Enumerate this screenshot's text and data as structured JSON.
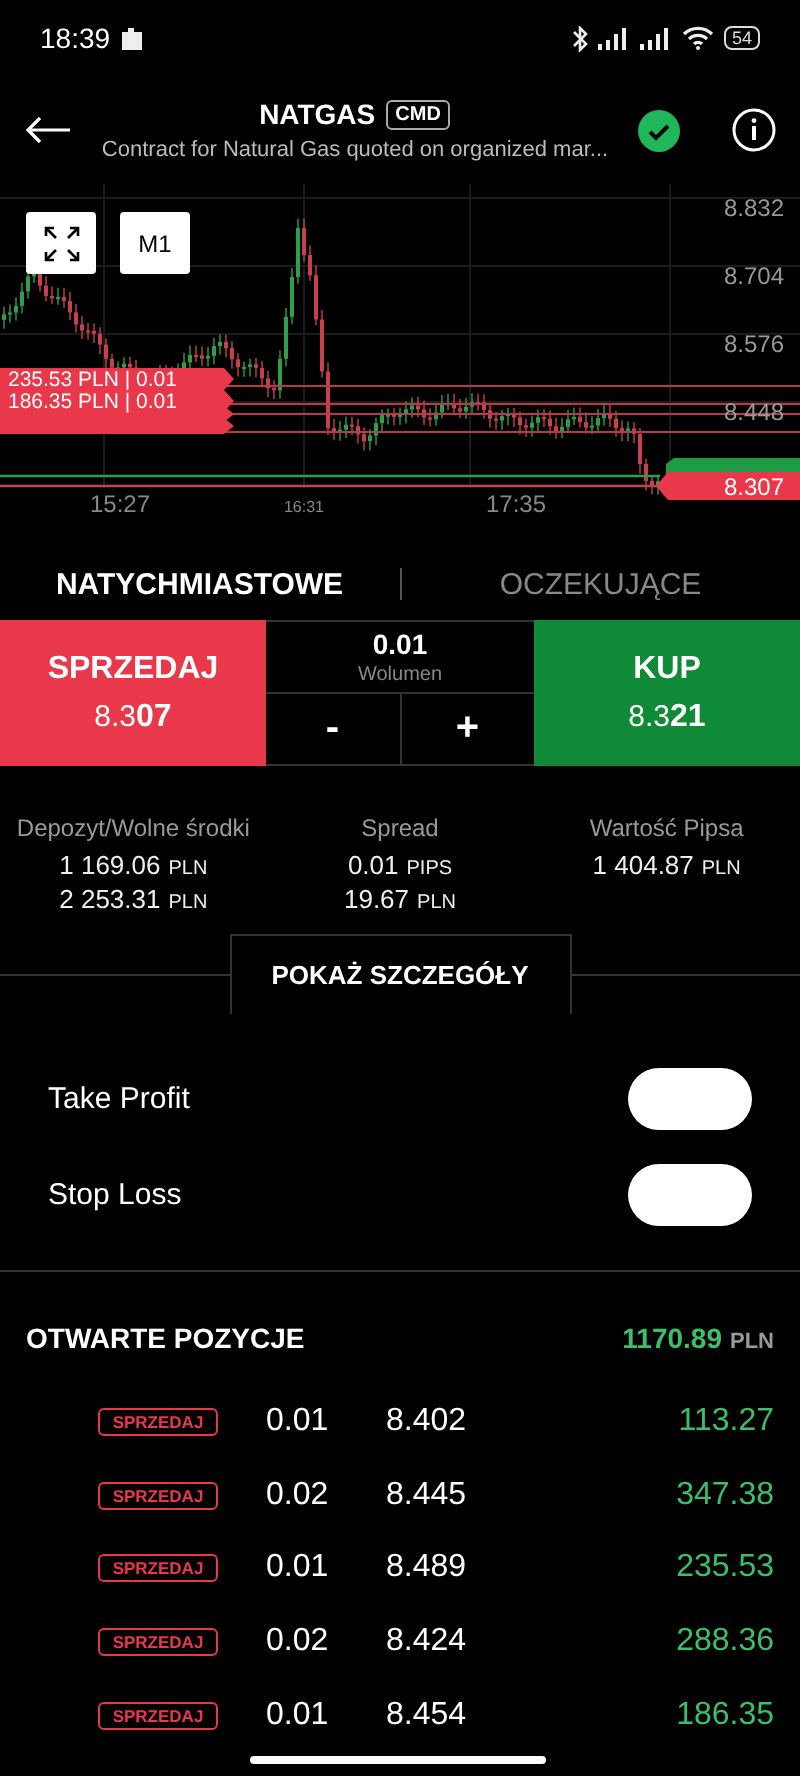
{
  "status_bar": {
    "time": "18:39",
    "battery": "54"
  },
  "header": {
    "title": "NATGAS",
    "badge": "CMD",
    "subtitle": "Contract for Natural Gas quoted on organized mar..."
  },
  "chart": {
    "timeframe": "M1",
    "y_ticks": [
      "8.832",
      "8.704",
      "8.576",
      "8.448"
    ],
    "x_ticks": [
      {
        "label": "15:27",
        "minor": false
      },
      {
        "label": "16:31",
        "minor": true
      },
      {
        "label": "17:35",
        "minor": false
      }
    ],
    "order_tags": [
      "235.53 PLN | 0.01",
      "186.35 PLN | 0.01"
    ],
    "price_tag": "8.307"
  },
  "order_tabs": [
    {
      "label": "NATYCHMIASTOWE",
      "selected": true
    },
    {
      "label": "OCZEKUJĄCE",
      "selected": false
    }
  ],
  "trade": {
    "sell": {
      "label": "SPRZEDAJ",
      "price": "8.3**07**"
    },
    "volume": {
      "value": "0.01",
      "label": "Wolumen"
    },
    "decrease": "-",
    "increase": "+",
    "buy": {
      "label": "KUP",
      "price": "8.3**21**"
    }
  },
  "stats": [
    {
      "label": "Depozyt/Wolne środki",
      "values": [
        {
          "amount": "1 169.06",
          "unit": "PLN"
        },
        {
          "amount": "2 253.31",
          "unit": "PLN"
        }
      ]
    },
    {
      "label": "Spread",
      "values": [
        {
          "amount": "0.01",
          "unit": "PIPS"
        },
        {
          "amount": "19.67",
          "unit": "PLN"
        }
      ]
    },
    {
      "label": "Wartość Pipsa",
      "values": [
        {
          "amount": "1 404.87",
          "unit": "PLN"
        }
      ]
    }
  ],
  "details_button": "POKAŻ SZCZEGÓŁY",
  "toggles": [
    {
      "label": "Take Profit",
      "on": false
    },
    {
      "label": "Stop Loss",
      "on": false
    }
  ],
  "positions": {
    "title": "OTWARTE POZYCJE",
    "total": "1170.89",
    "currency": "PLN",
    "rows": [
      {
        "side": "SPRZEDAJ",
        "volume": "0.01",
        "price": "8.402",
        "profit": "113.27"
      },
      {
        "side": "SPRZEDAJ",
        "volume": "0.02",
        "price": "8.445",
        "profit": "347.38"
      },
      {
        "side": "SPRZEDAJ",
        "volume": "0.01",
        "price": "8.489",
        "profit": "235.53"
      },
      {
        "side": "SPRZEDAJ",
        "volume": "0.02",
        "price": "8.424",
        "profit": "288.36"
      },
      {
        "side": "SPRZEDAJ",
        "volume": "0.01",
        "price": "8.454",
        "profit": "186.35"
      }
    ]
  }
}
